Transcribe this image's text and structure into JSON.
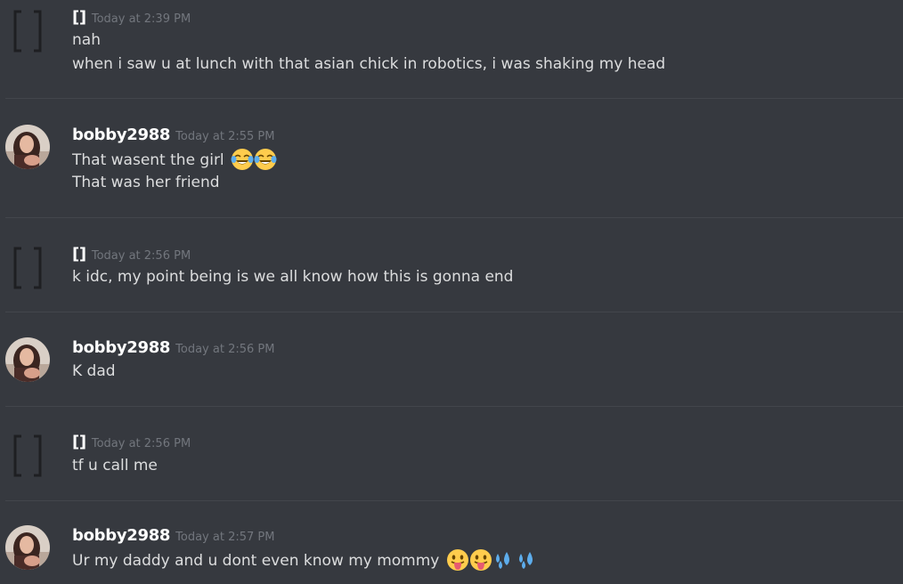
{
  "messages": [
    {
      "author": "[]",
      "timestamp": "Today at 2:39 PM",
      "lines": [
        "nah",
        "when i saw u at lunch with that asian chick in robotics, i was shaking my head"
      ]
    },
    {
      "author": "bobby2988",
      "timestamp": "Today at 2:55 PM",
      "lines": [
        "That wasent the girl",
        "That was her friend"
      ],
      "emojis": [
        "joy-emoji",
        "joy-emoji"
      ]
    },
    {
      "author": "[]",
      "timestamp": "Today at 2:56 PM",
      "lines": [
        "k idc, my point being is we all know how this is gonna end"
      ]
    },
    {
      "author": "bobby2988",
      "timestamp": "Today at 2:56 PM",
      "lines": [
        "K dad"
      ]
    },
    {
      "author": "[]",
      "timestamp": "Today at 2:56 PM",
      "lines": [
        "tf u call me"
      ]
    },
    {
      "author": "bobby2988",
      "timestamp": "Today at 2:57 PM",
      "lines": [
        "Ur my daddy and u dont even know my mommy"
      ],
      "emojis": [
        "tongue-emoji",
        "tongue-emoji",
        "sweat-droplets-emoji",
        "sweat-droplets-emoji"
      ]
    }
  ],
  "colors": {
    "background": "#36393f",
    "divider": "#43464c",
    "username": "#ffffff",
    "timestamp": "#72767d",
    "message_text": "#dcddde"
  }
}
